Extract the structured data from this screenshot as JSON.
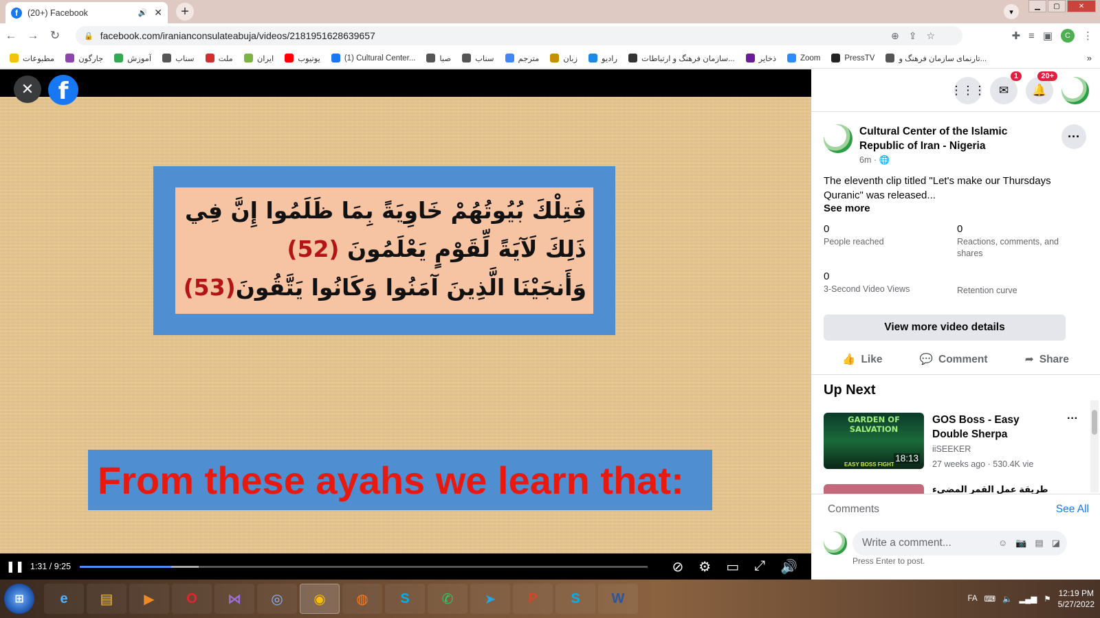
{
  "browser": {
    "tab_title": "(20+) Facebook",
    "tab_sound_icon": "speaker-icon",
    "url": "facebook.com/iranianconsulateabuja/videos/2181951628639657",
    "profile_letter": "C"
  },
  "bookmarks": [
    {
      "label": "مطبوعات",
      "color": "#f4c20d"
    },
    {
      "label": "جارگون",
      "color": "#8e44ad"
    },
    {
      "label": "آموزش",
      "color": "#34a853"
    },
    {
      "label": "سناب",
      "color": "#555555"
    },
    {
      "label": "ملت",
      "color": "#d32f2f"
    },
    {
      "label": "ایران",
      "color": "#7cb342"
    },
    {
      "label": "یوتیوب",
      "color": "#ff0000"
    },
    {
      "label": "(1) Cultural Center...",
      "color": "#1877f2"
    },
    {
      "label": "صبا",
      "color": "#555555"
    },
    {
      "label": "سناب",
      "color": "#555555"
    },
    {
      "label": "مترجم",
      "color": "#4285f4"
    },
    {
      "label": "زبان",
      "color": "#c49000"
    },
    {
      "label": "رادیو",
      "color": "#1e88e5"
    },
    {
      "label": "سازمان فرهنگ و ارتباطات...",
      "color": "#333333"
    },
    {
      "label": "ذخایر",
      "color": "#6a1b9a"
    },
    {
      "label": "Zoom",
      "color": "#2d8cff"
    },
    {
      "label": "PressTV",
      "color": "#222222"
    },
    {
      "label": "تارنمای سازمان فرهنگ و...",
      "color": "#555555"
    }
  ],
  "video": {
    "ayah_line1": "فَتِلْكَ بُيُوتُهُمْ خَاوِيَةً بِمَا ظَلَمُوا إِنَّ فِي",
    "ayah_line2a": "ذَلِكَ لَآيَةً لِّقَوْمٍ يَعْلَمُونَ ",
    "ayah_num1": "(52)",
    "ayah_line3a": "وَأَنجَيْنَا الَّذِينَ آمَنُوا وَكَانُوا يَتَّقُونَ",
    "ayah_num2": "(53)",
    "learn_text": "From these ayahs we learn that:",
    "time": "1:31 / 9:25",
    "progress": 0.161,
    "buffered": 0.21
  },
  "panel": {
    "messenger_badge": "1",
    "notif_badge": "20+",
    "page_name": "Cultural Center of the Islamic Republic of Iran - Nigeria",
    "post_meta": "6m · ",
    "description": "The eleventh clip titled \"Let's make our Thursdays Quranic\" was released...",
    "see_more": "See more",
    "stats": {
      "people_reached_val": "0",
      "people_reached": "People reached",
      "reactions_val": "0",
      "reactions": "Reactions, comments, and shares",
      "views_val": "0",
      "views": "3-Second Video Views",
      "retention": "Retention curve"
    },
    "view_more": "View more video details",
    "like": "Like",
    "comment": "Comment",
    "share": "Share",
    "up_next": "Up Next",
    "next_video": {
      "thumb_title": "GARDEN OF SALVATION",
      "thumb_sub": "EASY BOSS FIGHT",
      "duration": "18:13",
      "title": "GOS Boss - Easy Double Sherpa",
      "channel": "iiSEEKER",
      "meta": "27 weeks ago · 530.4K vie"
    },
    "next_video2_title": "طريقة عمل القمر المضيء",
    "comments_label": "Comments",
    "see_all": "See All",
    "comment_placeholder": "Write a comment...",
    "press_enter": "Press Enter to post."
  },
  "taskbar": {
    "lang": "FA",
    "time": "12:19 PM",
    "date": "5/27/2022"
  }
}
